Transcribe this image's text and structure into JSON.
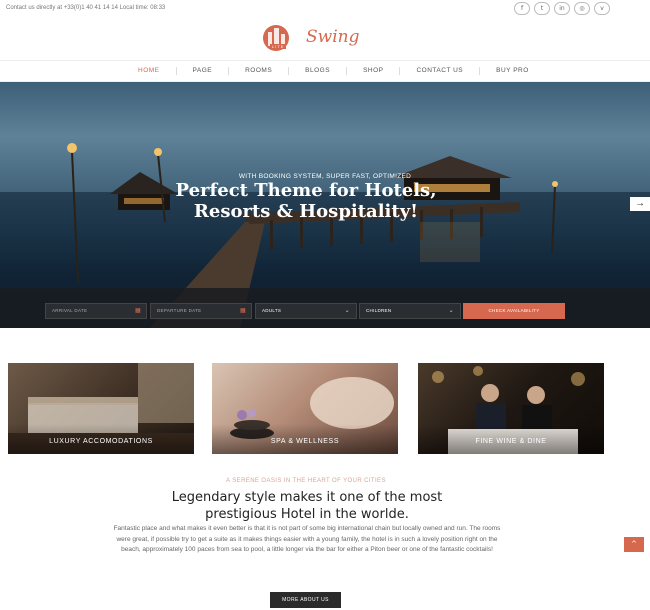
{
  "topbar": {
    "contact": "Contact us directly at +33(0)1 40 41 14 14 Local time: 08:33",
    "socials": [
      {
        "icon": "facebook-icon",
        "glyph": "f"
      },
      {
        "icon": "twitter-icon",
        "glyph": "t"
      },
      {
        "icon": "linkedin-icon",
        "glyph": "in"
      },
      {
        "icon": "instagram-icon",
        "glyph": "◎"
      },
      {
        "icon": "vimeo-icon",
        "glyph": "v"
      }
    ]
  },
  "logo": {
    "name": "Swing",
    "badge": "LITE"
  },
  "nav": {
    "items": [
      "HOME",
      "PAGE",
      "ROOMS",
      "BLOGS",
      "SHOP",
      "CONTACT US",
      "BUY PRO"
    ],
    "active": "HOME"
  },
  "hero": {
    "kicker": "WITH BOOKING SYSTEM, SUPER FAST, OPTIMIZED",
    "title_line1": "Perfect Theme for Hotels,",
    "title_line2": "Resorts & Hospitality!",
    "next_arrow": "→"
  },
  "booking": {
    "arrival_placeholder": "ARRIVAL DATE",
    "departure_placeholder": "DEPARTURE DATE",
    "adults_label": "ADULTS",
    "children_label": "CHILDREN",
    "calendar_icon": "▦",
    "chevron": "⌄",
    "check_label": "CHECK AVAILABILITY"
  },
  "features": [
    {
      "label": "LUXURY ACCOMODATIONS"
    },
    {
      "label": "SPA & WELLNESS"
    },
    {
      "label": "FINE WINE & DINE"
    }
  ],
  "about": {
    "kicker": "A SERENE OASIS IN THE HEART OF YOUR CITIES",
    "headline_line1": "Legendary style makes it one of the most",
    "headline_line2": "prestigious Hotel in the worlde.",
    "paragraph": "Fantastic place and what makes it even better is that it is not part of some big international chain but locally owned and run. The rooms were great, if possible try to get a suite as it makes things easier with a young family, the hotel is in such a lovely position right on the beach, approximately 100 paces from sea to pool, a little longer via the bar for either a Piton beer or one of the fantastic cocktails!",
    "button": "MORE ABOUT US",
    "scroll_top": "^"
  },
  "colors": {
    "accent": "#d5684e",
    "dark": "#2b2b2b"
  }
}
